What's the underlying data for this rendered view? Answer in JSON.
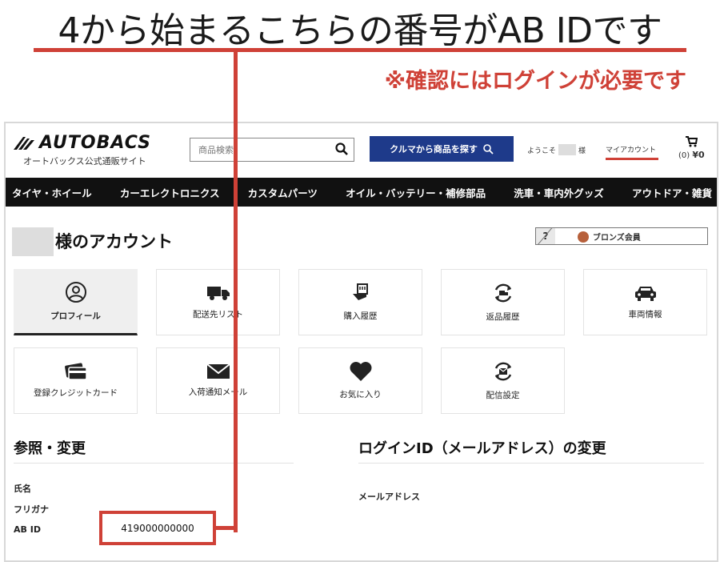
{
  "annotation": {
    "headline": "4から始まるこちらの番号がAB IDです",
    "notice": "※確認にはログインが必要です"
  },
  "header": {
    "logo_text": "AUTOBACS",
    "logo_sub": "オートバックス公式通販サイト",
    "search_placeholder": "商品検索",
    "car_search_button": "クルマから商品を探す",
    "greeting_prefix": "ようこそ",
    "greeting_suffix": "様",
    "my_account": "マイアカウント",
    "cart_count": "(0)",
    "cart_total": "¥0"
  },
  "nav": {
    "items": [
      "タイヤ・ホイール",
      "カーエレクトロニクス",
      "カスタムパーツ",
      "オイル・バッテリー・補修部品",
      "洗車・車内外グッズ",
      "アウトドア・雑貨"
    ]
  },
  "account": {
    "title": "様のアカウント",
    "help": "?",
    "rank": "ブロンズ会員"
  },
  "tiles": [
    {
      "label": "プロフィール",
      "icon": "user-circle-icon"
    },
    {
      "label": "配送先リスト",
      "icon": "truck-icon"
    },
    {
      "label": "購入履歴",
      "icon": "receipt-hand-icon"
    },
    {
      "label": "返品履歴",
      "icon": "return-truck-icon"
    },
    {
      "label": "車両情報",
      "icon": "car-icon"
    },
    {
      "label": "登録クレジットカード",
      "icon": "credit-card-icon"
    },
    {
      "label": "入荷通知メール",
      "icon": "envelope-icon"
    },
    {
      "label": "お気に入り",
      "icon": "heart-icon"
    },
    {
      "label": "配信設定",
      "icon": "mail-refresh-icon"
    }
  ],
  "reference": {
    "heading": "参照・変更",
    "name_label": "氏名",
    "kana_label": "フリガナ",
    "abid_label": "AB ID",
    "abid_value": "419000000000"
  },
  "login": {
    "heading": "ログインID（メールアドレス）の変更",
    "email_label": "メールアドレス"
  },
  "colors": {
    "accent_red": "#cf4137",
    "nav_black": "#111111",
    "button_blue": "#1e3a8a",
    "bronze": "#b7603b"
  }
}
